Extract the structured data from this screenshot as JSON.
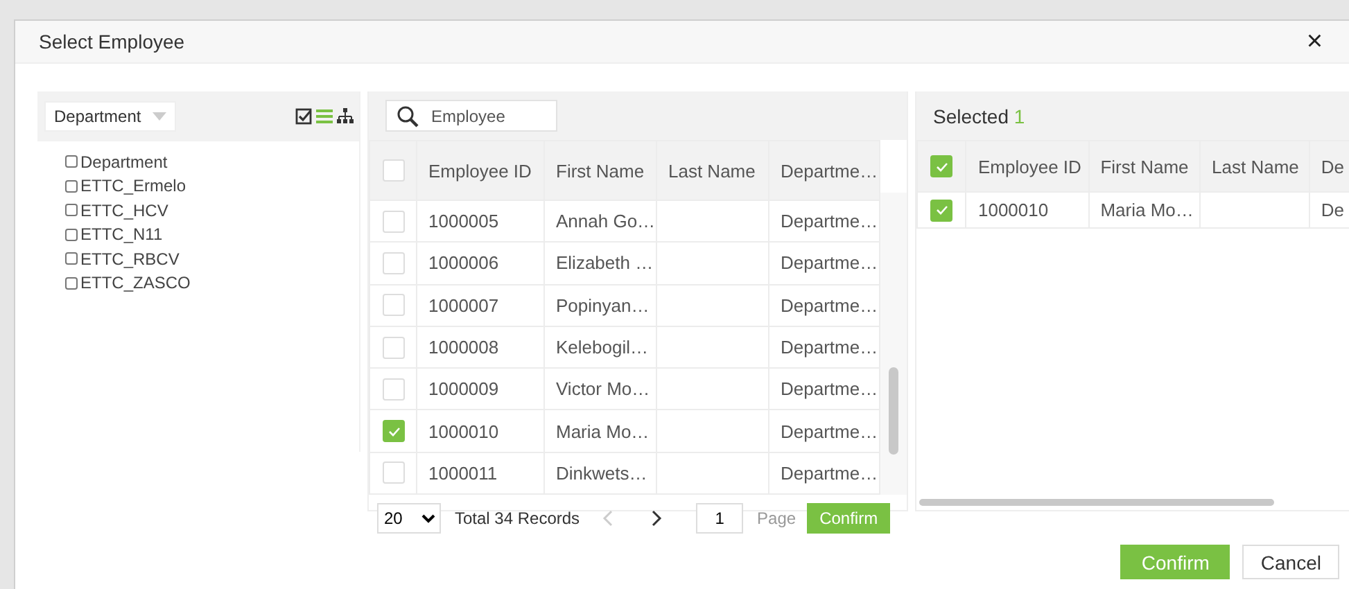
{
  "window": {
    "title": "Select Employee",
    "close": "×"
  },
  "tree_panel": {
    "filter": "Department",
    "view_buttons": [
      {
        "kind": "check",
        "selected": false
      },
      {
        "kind": "list",
        "selected": true
      },
      {
        "kind": "tree",
        "selected": false
      }
    ],
    "items": [
      {
        "label": "Department",
        "checked": false
      },
      {
        "label": "ETTC_Ermelo",
        "checked": false
      },
      {
        "label": "ETTC_HCV",
        "checked": false
      },
      {
        "label": "ETTC_N11",
        "checked": false
      },
      {
        "label": "ETTC_RBCV",
        "checked": false
      },
      {
        "label": "ETTC_ZASCO",
        "checked": false
      }
    ]
  },
  "employee_grid": {
    "search_placeholder": "Employee",
    "all_checked": false,
    "columns": [
      "Employee ID",
      "First Name",
      "Last Name",
      "Departme…"
    ],
    "rows": [
      {
        "id": "1000005",
        "first_name": "Annah Go…",
        "department": "Departme…",
        "checked": false
      },
      {
        "id": "1000006",
        "first_name": "Elizabeth …",
        "department": "Departme…",
        "checked": false
      },
      {
        "id": "1000007",
        "first_name": "Popinyan…",
        "department": "Departme…",
        "checked": false
      },
      {
        "id": "1000008",
        "first_name": "Kelebogil…",
        "department": "Departme…",
        "checked": false
      },
      {
        "id": "1000009",
        "first_name": "Victor Mo…",
        "department": "Departme…",
        "checked": false
      },
      {
        "id": "1000010",
        "first_name": "Maria Mo…",
        "department": "Departme…",
        "checked": true
      },
      {
        "id": "1000011",
        "first_name": "Dinkwets…",
        "department": "Departme…",
        "checked": false
      }
    ],
    "pagination": {
      "page_size": "20",
      "total": "Total 34 Records",
      "page": "1",
      "page_label": "Page",
      "confirm": "Confirm"
    }
  },
  "selected_panel": {
    "label": "Selected",
    "count": "1",
    "all_checked": true,
    "columns": [
      "Employee ID",
      "First Name",
      "Last Name",
      "De"
    ],
    "rows": [
      {
        "id": "1000010",
        "first_name": "Maria Mo…",
        "department": "De",
        "checked": true
      }
    ]
  },
  "buttons": [
    {
      "label": "Confirm",
      "kind": "primary"
    },
    {
      "label": "Cancel",
      "kind": "secondary"
    }
  ]
}
